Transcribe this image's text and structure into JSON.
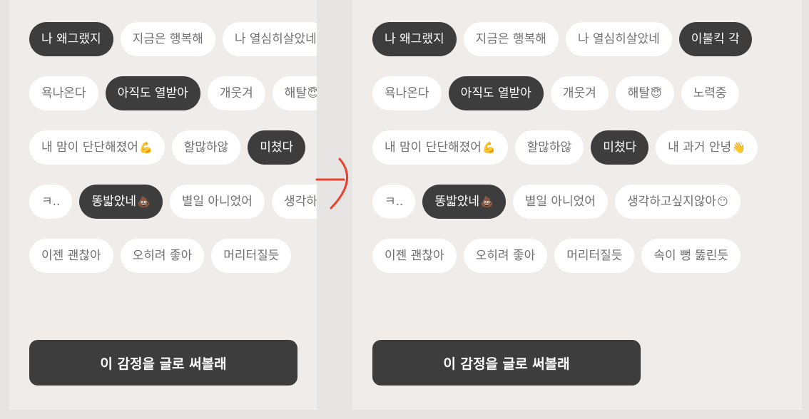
{
  "colors": {
    "page_background": "#e6e5e3",
    "panel_background": "#efecea",
    "chip_default": "#ffffff",
    "chip_selected": "#3d3d3d",
    "chip_text_default": "#707070",
    "chip_text_selected": "#ffffff",
    "cta_background": "#3d3d3d",
    "arrow": "#e8432e"
  },
  "left_screen": {
    "rows": [
      [
        {
          "label": "나 왜그랬지",
          "selected": true
        },
        {
          "label": "지금은 행복해",
          "selected": false
        },
        {
          "label": "나 열심히살았네",
          "selected": false
        }
      ],
      [
        {
          "label": "욕나온다",
          "selected": false
        },
        {
          "label": "아직도 열받아",
          "selected": true
        },
        {
          "label": "개웃겨",
          "selected": false
        },
        {
          "label": "해탈",
          "emoji": "😇",
          "selected": false
        }
      ],
      [
        {
          "label": "내 맘이 단단해졌어",
          "emoji": "💪",
          "selected": false
        },
        {
          "label": "할많하않",
          "selected": false
        },
        {
          "label": "미쳤다",
          "selected": true
        }
      ],
      [
        {
          "label": "ㅋ..",
          "selected": false
        },
        {
          "label": "똥밟았네",
          "emoji": "💩",
          "selected": true
        },
        {
          "label": "별일 아니었어",
          "selected": false
        },
        {
          "label": "생각하고싶지않아",
          "emoji": "😶",
          "selected": false
        }
      ],
      [
        {
          "label": "이젠 괜찮아",
          "selected": false
        },
        {
          "label": "오히려 좋아",
          "selected": false
        },
        {
          "label": "머리터질듯",
          "selected": false
        }
      ]
    ],
    "cta_label": "이 감정을 글로 써볼래"
  },
  "right_screen": {
    "rows": [
      [
        {
          "label": "나 왜그랬지",
          "selected": true
        },
        {
          "label": "지금은 행복해",
          "selected": false
        },
        {
          "label": "나 열심히살았네",
          "selected": false
        },
        {
          "label": "이불킥 각",
          "selected": true
        }
      ],
      [
        {
          "label": "욕나온다",
          "selected": false
        },
        {
          "label": "아직도 열받아",
          "selected": true
        },
        {
          "label": "개웃겨",
          "selected": false
        },
        {
          "label": "해탈",
          "emoji": "😇",
          "selected": false
        },
        {
          "label": "노력중",
          "selected": false
        }
      ],
      [
        {
          "label": "내 맘이 단단해졌어",
          "emoji": "💪",
          "selected": false
        },
        {
          "label": "할많하않",
          "selected": false
        },
        {
          "label": "미쳤다",
          "selected": true
        },
        {
          "label": "내 과거 안녕",
          "emoji": "👋",
          "selected": false
        }
      ],
      [
        {
          "label": "ㅋ..",
          "selected": false
        },
        {
          "label": "똥밟았네",
          "emoji": "💩",
          "selected": true
        },
        {
          "label": "별일 아니었어",
          "selected": false
        },
        {
          "label": "생각하고싶지않아",
          "emoji": "😶",
          "selected": false
        }
      ],
      [
        {
          "label": "이젠 괜찮아",
          "selected": false
        },
        {
          "label": "오히려 좋아",
          "selected": false
        },
        {
          "label": "머리터질듯",
          "selected": false
        },
        {
          "label": "속이 뻥 뚫린듯",
          "selected": false
        }
      ]
    ],
    "cta_label": "이 감정을 글로 써볼래"
  }
}
